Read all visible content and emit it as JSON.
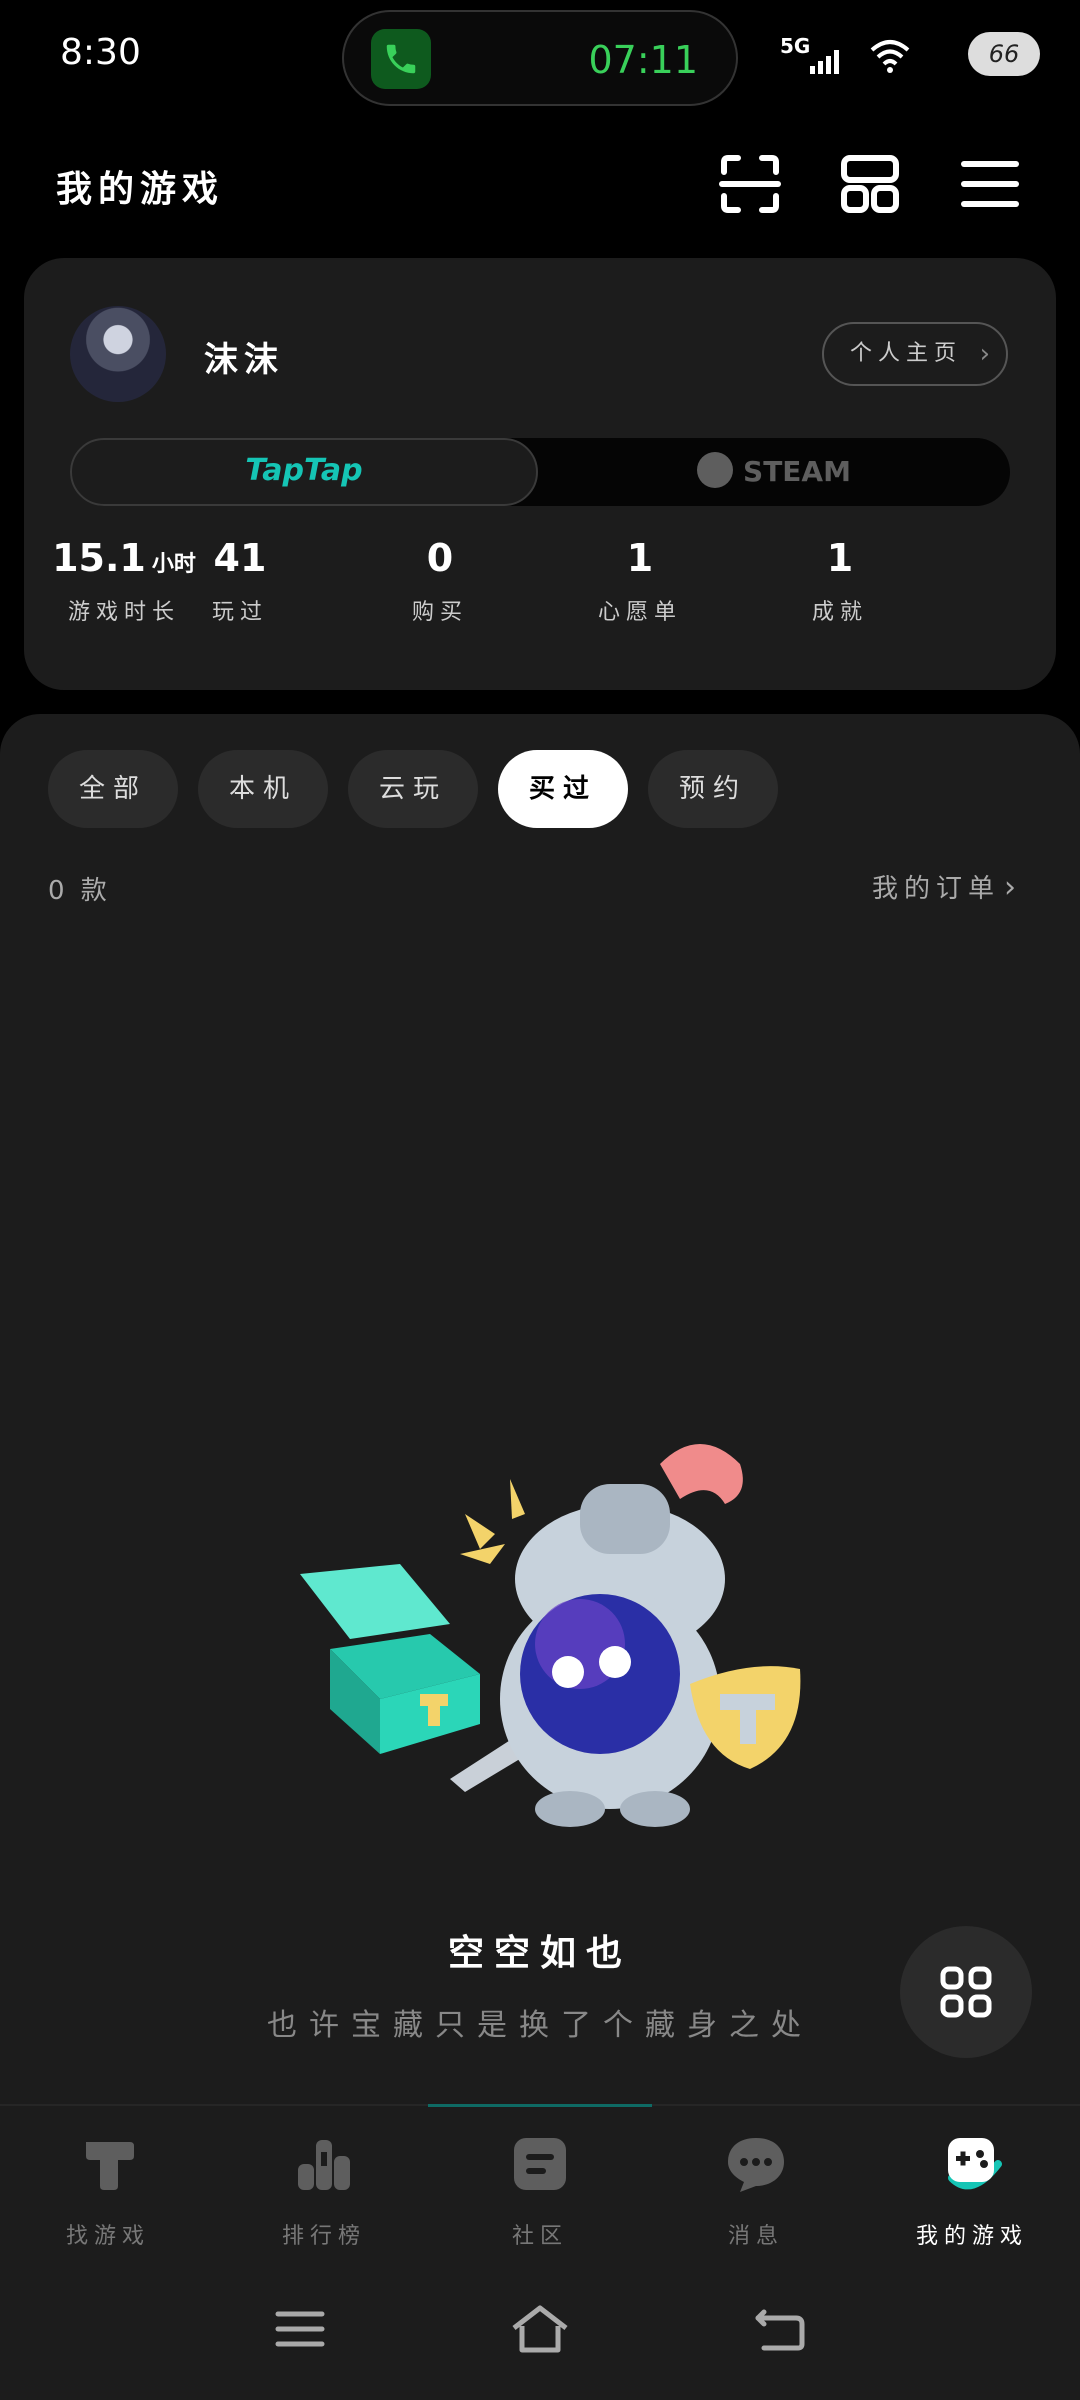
{
  "status_bar": {
    "time": "8:30",
    "call_timer": "07:11",
    "network": "5G",
    "battery": "66"
  },
  "header": {
    "title": "我的游戏"
  },
  "profile": {
    "username": "沫沫",
    "homepage_label": "个人主页",
    "platforms": {
      "taptap": "TapTap",
      "steam": "STEAM",
      "selected": "TapTap"
    },
    "stats": [
      {
        "value": "15.1",
        "unit": "小时",
        "label": "游戏时长"
      },
      {
        "value": "41",
        "unit": "",
        "label": "玩过"
      },
      {
        "value": "0",
        "unit": "",
        "label": "购买"
      },
      {
        "value": "1",
        "unit": "",
        "label": "心愿单"
      },
      {
        "value": "1",
        "unit": "",
        "label": "成就"
      }
    ]
  },
  "filters": {
    "items": [
      "全部",
      "本机",
      "云玩",
      "买过",
      "预约"
    ],
    "selected": "买过"
  },
  "list": {
    "count": "0 款",
    "orders_label": "我的订单"
  },
  "empty_state": {
    "title": "空空如也",
    "subtitle": "也许宝藏只是换了个藏身之处"
  },
  "tabs": {
    "items": [
      {
        "label": "找游戏",
        "icon": "taptap-logo-icon"
      },
      {
        "label": "排行榜",
        "icon": "ranking-icon"
      },
      {
        "label": "社区",
        "icon": "community-icon"
      },
      {
        "label": "消息",
        "icon": "message-icon"
      },
      {
        "label": "我的游戏",
        "icon": "my-games-icon"
      }
    ],
    "selected": "我的游戏"
  },
  "colors": {
    "accent": "#15c5b5",
    "call_green": "#39d05a",
    "card_bg": "#1c1c1c",
    "background": "#000000"
  }
}
